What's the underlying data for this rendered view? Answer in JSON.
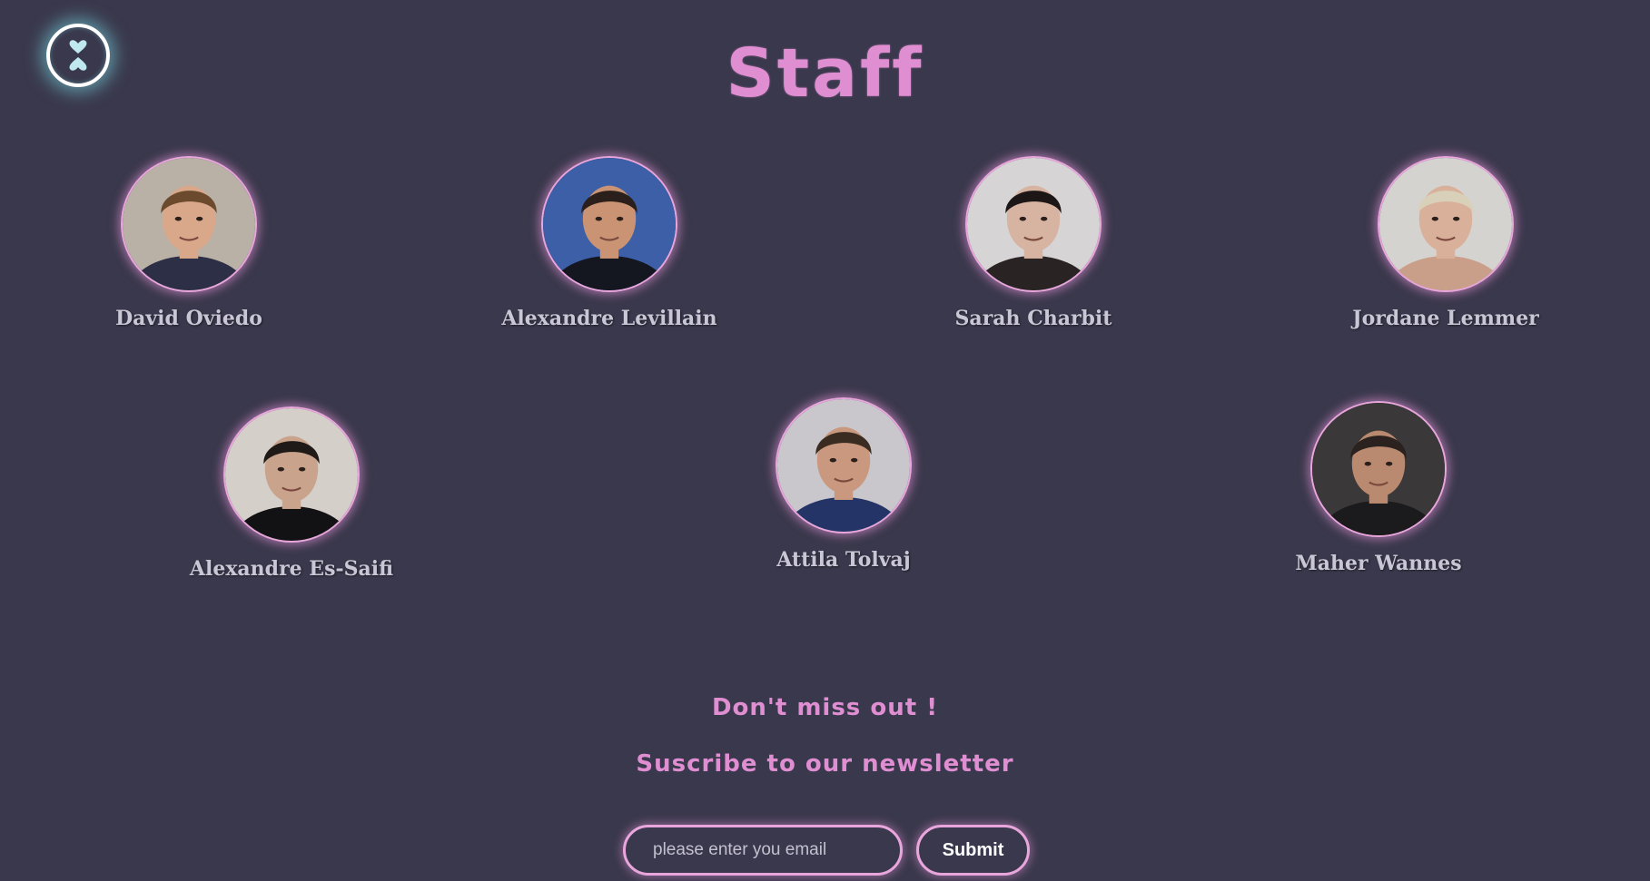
{
  "header": {
    "logo_icon": "hourglass-heart-icon",
    "title": "Staff"
  },
  "staff": [
    {
      "name": "David Oviedo",
      "skin": "#d9a88a",
      "hair": "#6b4a2e",
      "shirt": "#2c2f45",
      "bg": "#b9b0a6"
    },
    {
      "name": "Alexandre Levillain",
      "skin": "#c99374",
      "hair": "#2a1f1a",
      "shirt": "#141620",
      "bg": "#3d5fa8"
    },
    {
      "name": "Sarah Charbit",
      "skin": "#d7b3a2",
      "hair": "#1c1716",
      "shirt": "#2a2324",
      "bg": "#d6d4d4"
    },
    {
      "name": "Jordane Lemmer",
      "skin": "#d9b09a",
      "hair": "#d8d0b8",
      "shirt": "#c99f8a",
      "bg": "#d5d3cf"
    },
    {
      "name": "Alexandre Es-Saifi",
      "skin": "#c9a38c",
      "hair": "#1f1a18",
      "shirt": "#121214",
      "bg": "#d4cfc8"
    },
    {
      "name": "Attila Tolvaj",
      "skin": "#c9987e",
      "hair": "#3b2c22",
      "shirt": "#243466",
      "bg": "#c9c7cc"
    },
    {
      "name": "Maher Wannes",
      "skin": "#b98a70",
      "hair": "#2b2220",
      "shirt": "#1b1b1d",
      "bg": "#3a3838"
    }
  ],
  "newsletter": {
    "title": "Don't miss out !",
    "subtitle": "Suscribe to our newsletter",
    "email_placeholder": "please enter you email",
    "email_value": "",
    "submit_label": "Submit"
  },
  "colors": {
    "background": "#3a384c",
    "accent_pink": "#e08ed2",
    "name_text": "#c9c6d6",
    "logo_glow": "#78dce6"
  }
}
